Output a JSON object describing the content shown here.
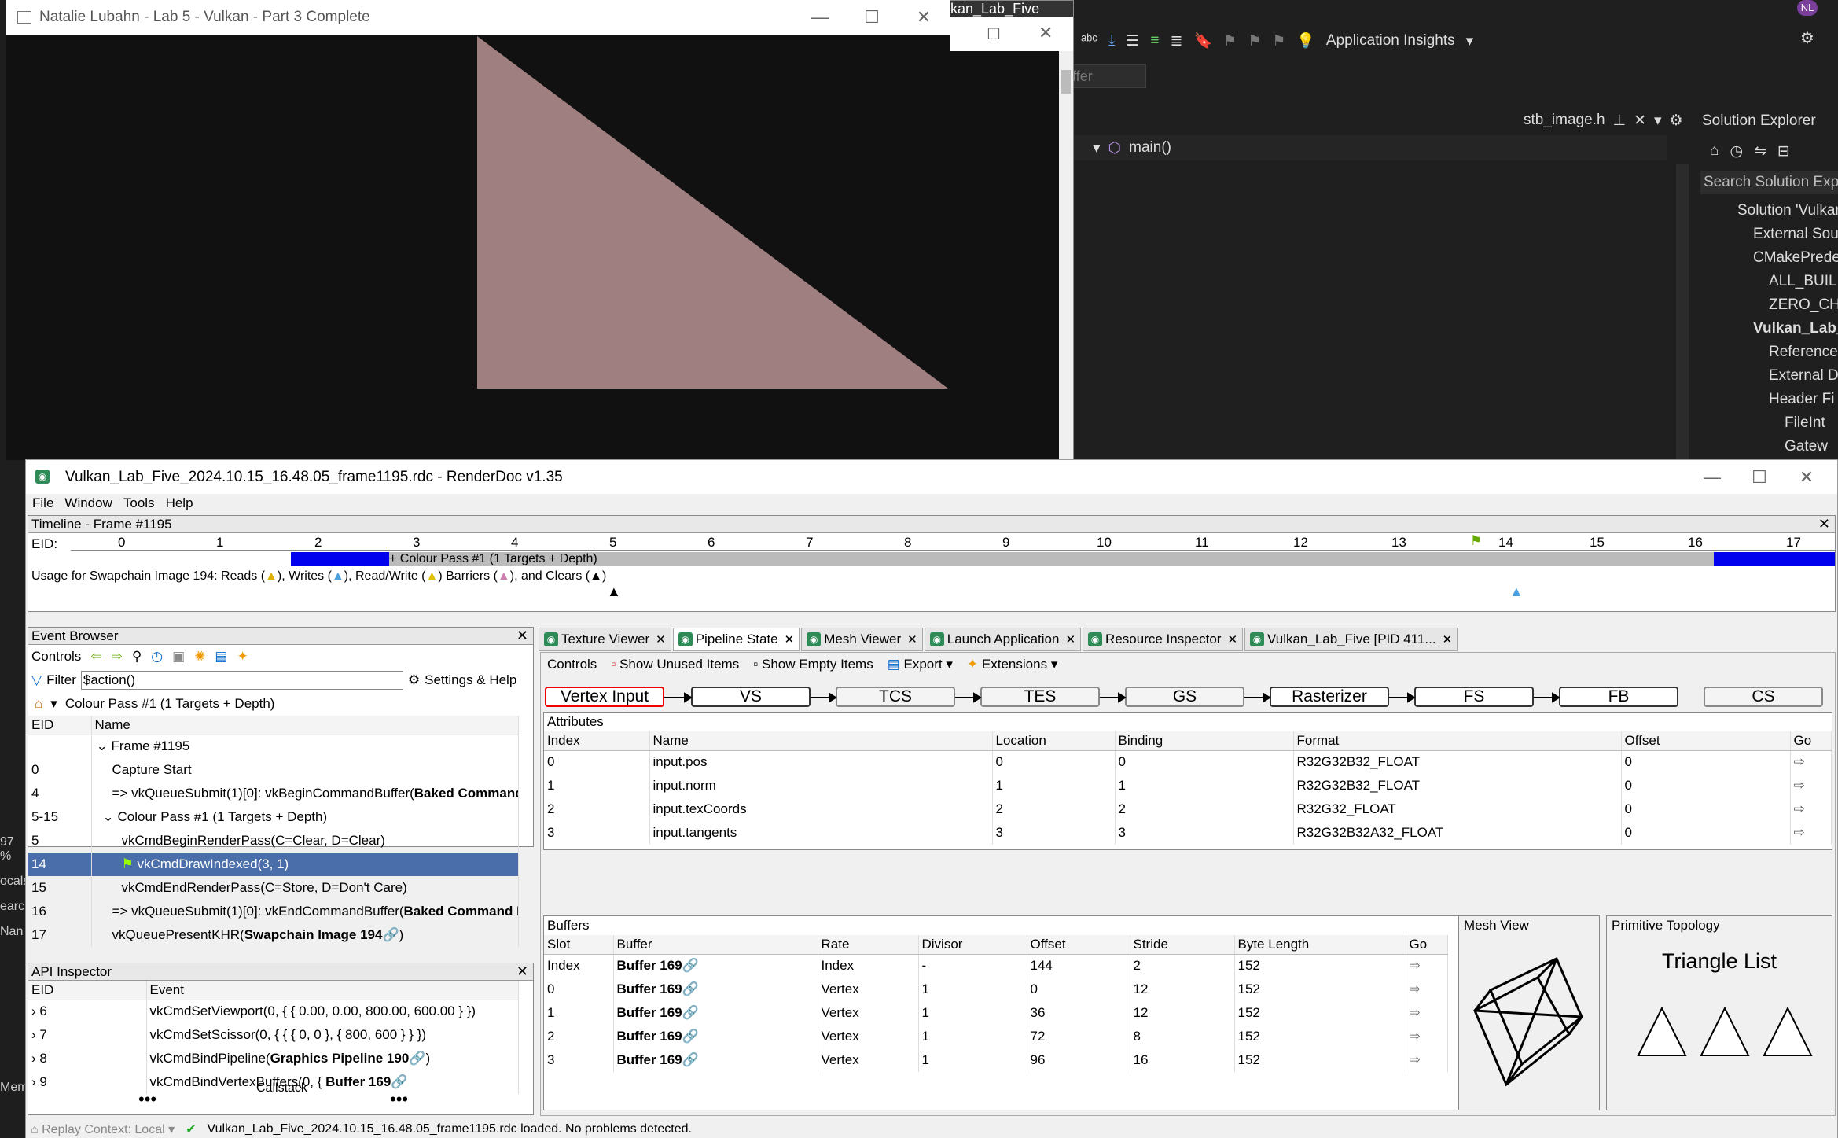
{
  "app_window": {
    "title": "Natalie Lubahn - Lab 5 - Vulkan - Part 3 Complete"
  },
  "second_window": {
    "title": "kan_Lab_Five"
  },
  "vs": {
    "app_insights": "Application Insights",
    "combo_text": "ryBuffer",
    "file_tab": "stb_image.h",
    "function": "main()",
    "user_initials": "NL",
    "solution_explorer": "Solution Explorer",
    "search_placeholder": "Search Solution Explo",
    "tree": [
      "Solution 'Vulkan",
      "External Sour",
      "CMakePrede",
      "ALL_BUILD",
      "ZERO_CH",
      "Vulkan_Lab_",
      "Reference",
      "External D",
      "Header Fi",
      "FileInt",
      "Gatew"
    ],
    "left_strip": [
      "97 %",
      "ocals",
      "earc",
      "Nan",
      "Mem"
    ]
  },
  "renderdoc": {
    "title": "Vulkan_Lab_Five_2024.10.15_16.48.05_frame1195.rdc - RenderDoc v1.35",
    "menu": [
      "File",
      "Window",
      "Tools",
      "Help"
    ],
    "timeline": {
      "title": "Timeline - Frame #1195",
      "eid_label": "EID:",
      "ticks": [
        "0",
        "1",
        "2",
        "3",
        "4",
        "5",
        "6",
        "7",
        "8",
        "9",
        "10",
        "11",
        "12",
        "13",
        "14",
        "15",
        "16",
        "17"
      ],
      "pass_label": "+ Colour Pass #1 (1 Targets + Depth)",
      "usage": "Usage for Swapchain Image 194: Reads (",
      "usage_writes": "), Writes (",
      "usage_rw": "), Read/Write (",
      "usage_barriers": ") Barriers (",
      "usage_clears": "), and Clears (",
      "usage_end": ")"
    },
    "event_browser": {
      "title": "Event Browser",
      "controls": "Controls",
      "filter_label": "Filter",
      "filter_value": "$action()",
      "settings": "Settings & Help",
      "breadcrumb": "Colour Pass #1 (1 Targets + Depth)",
      "col_eid": "EID",
      "col_name": "Name",
      "rows": [
        {
          "eid": "",
          "name": "Frame #1195",
          "bold": ""
        },
        {
          "eid": "0",
          "name": "Capture Start",
          "bold": ""
        },
        {
          "eid": "4",
          "name": "=> vkQueueSubmit(1)[0]: vkBeginCommandBuffer(",
          "bold": "Baked Command"
        },
        {
          "eid": "5-15",
          "name": "Colour Pass #1 (1 Targets + Depth)",
          "bold": ""
        },
        {
          "eid": "5",
          "name": "vkCmdBeginRenderPass(C=Clear, D=Clear)",
          "bold": ""
        },
        {
          "eid": "14",
          "name": "vkCmdDrawIndexed(3, 1)",
          "bold": ""
        },
        {
          "eid": "15",
          "name": "vkCmdEndRenderPass(C=Store, D=Don't Care)",
          "bold": ""
        },
        {
          "eid": "16",
          "name": "=> vkQueueSubmit(1)[0]: vkEndCommandBuffer(",
          "bold": "Baked Command B"
        },
        {
          "eid": "17",
          "name": "vkQueuePresentKHR(",
          "bold": "Swapchain Image 194"
        }
      ]
    },
    "api_inspector": {
      "title": "API Inspector",
      "col_eid": "EID",
      "col_event": "Event",
      "rows": [
        {
          "eid": "6",
          "event": "vkCmdSetViewport(0, { { 0.00, 0.00, 800.00, 600.00 } })",
          "bold": ""
        },
        {
          "eid": "7",
          "event": "vkCmdSetScissor(0, { { { 0, 0 }, { 800, 600 } } })",
          "bold": ""
        },
        {
          "eid": "8",
          "event": "vkCmdBindPipeline(",
          "bold": "Graphics Pipeline 190"
        },
        {
          "eid": "9",
          "event": "vkCmdBindVertexBuffers(0, {",
          "bold": "Buffer 169"
        }
      ],
      "callstack": "Callstack"
    },
    "tabs": [
      "Texture Viewer",
      "Pipeline State",
      "Mesh Viewer",
      "Launch Application",
      "Resource Inspector",
      "Vulkan_Lab_Five [PID 411..."
    ],
    "pipeline": {
      "controls": "Controls",
      "show_unused": "Show Unused Items",
      "show_empty": "Show Empty Items",
      "export": "Export",
      "extensions": "Extensions",
      "stages": [
        "Vertex Input",
        "VS",
        "TCS",
        "TES",
        "GS",
        "Rasterizer",
        "FS",
        "FB",
        "CS"
      ],
      "attributes_title": "Attributes",
      "attr_headers": [
        "Index",
        "Name",
        "Location",
        "Binding",
        "Format",
        "Offset",
        "Go"
      ],
      "attributes": [
        [
          "0",
          "input.pos",
          "0",
          "0",
          "R32G32B32_FLOAT",
          "0"
        ],
        [
          "1",
          "input.norm",
          "1",
          "1",
          "R32G32B32_FLOAT",
          "0"
        ],
        [
          "2",
          "input.texCoords",
          "2",
          "2",
          "R32G32_FLOAT",
          "0"
        ],
        [
          "3",
          "input.tangents",
          "3",
          "3",
          "R32G32B32A32_FLOAT",
          "0"
        ]
      ],
      "buffers_title": "Buffers",
      "buf_headers": [
        "Slot",
        "Buffer",
        "Rate",
        "Divisor",
        "Offset",
        "Stride",
        "Byte Length",
        "Go"
      ],
      "buffers": [
        [
          "Index",
          "Buffer 169",
          "Index",
          "-",
          "144",
          "2",
          "152"
        ],
        [
          "0",
          "Buffer 169",
          "Vertex",
          "1",
          "0",
          "12",
          "152"
        ],
        [
          "1",
          "Buffer 169",
          "Vertex",
          "1",
          "36",
          "12",
          "152"
        ],
        [
          "2",
          "Buffer 169",
          "Vertex",
          "1",
          "72",
          "8",
          "152"
        ],
        [
          "3",
          "Buffer 169",
          "Vertex",
          "1",
          "96",
          "16",
          "152"
        ]
      ],
      "mesh_view": "Mesh View",
      "prim_topology": "Primitive Topology",
      "topology": "Triangle List"
    },
    "status": {
      "context": "Replay Context: Local",
      "message": "Vulkan_Lab_Five_2024.10.15_16.48.05_frame1195.rdc loaded. No problems detected."
    }
  }
}
